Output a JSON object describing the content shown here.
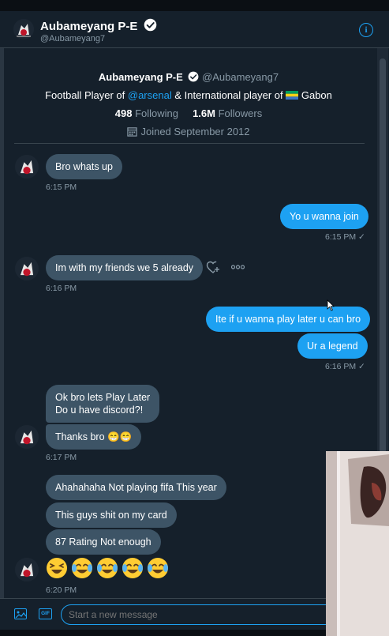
{
  "header": {
    "name": "Aubameyang P-E",
    "handle": "@Aubameyang7",
    "info_icon": "i"
  },
  "profile": {
    "name": "Aubameyang P-E",
    "handle": "@Aubameyang7",
    "bio_prefix": "Football Player of ",
    "bio_link": "@arsenal",
    "bio_mid": " & International player of ",
    "bio_country": " Gabon",
    "following_count": "498",
    "following_label": " Following",
    "followers_count": "1.6M",
    "followers_label": " Followers",
    "joined": "Joined September 2012"
  },
  "messages": {
    "m1": "Bro whats up",
    "t1": "6:15 PM",
    "m2": "Yo u wanna join",
    "t2": "6:15 PM ✓",
    "m3": "Im with my friends we 5 already",
    "t3": "6:16 PM",
    "m4": "Ite if u wanna play later u can bro",
    "m5": "Ur a legend",
    "t5": "6:16 PM ✓",
    "m6a": "Ok bro lets Play Later",
    "m6b": "Do u have discord?!",
    "m7": "Thanks bro 😁😁",
    "t7": "6:17 PM",
    "m8": "Ahahahaha Not playing fifa This year",
    "m9": "This guys shit on my card",
    "m10": "87 Rating Not enough",
    "m11": "😆😂😂😂😂",
    "t11": "6:20 PM"
  },
  "composer": {
    "placeholder": "Start a new message",
    "gif_label": "GIF"
  },
  "colors": {
    "background": "#15202b",
    "accent": "#1da1f2",
    "incoming_bubble": "#3d5466",
    "muted_text": "#8899a6"
  },
  "icons": [
    "verified-icon",
    "info-icon",
    "calendar-icon",
    "heart-plus-icon",
    "more-icon",
    "image-icon",
    "gif-icon",
    "flag-icon",
    "laughing-emoji-icon",
    "tears-of-joy-emoji-icon"
  ]
}
